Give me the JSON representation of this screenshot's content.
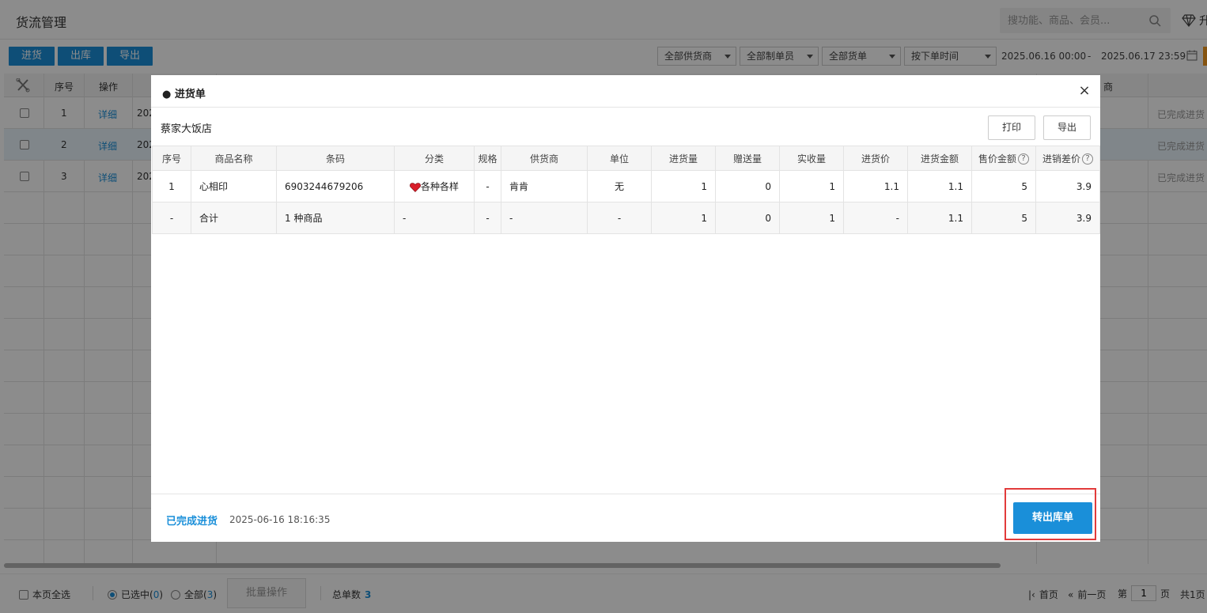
{
  "header": {
    "title": "货流管理",
    "search_placeholder": "搜功能、商品、会员...",
    "upgrade_label": "升"
  },
  "toolbar": {
    "purchase_label": "进货",
    "outbound_label": "出库",
    "export_label": "导出",
    "filters": {
      "supplier": "全部供货商",
      "creator": "全部制单员",
      "type": "全部货单",
      "time_mode": "按下单时间",
      "date_from": "2025.06.16 00:00",
      "date_sep": "-",
      "date_to": "2025.06.17 23:59"
    }
  },
  "grid": {
    "columns": [
      "序号",
      "操作",
      "商"
    ],
    "rows": [
      {
        "no": "1",
        "action": "详细",
        "prefix": "202",
        "status": "已完成进货"
      },
      {
        "no": "2",
        "action": "详细",
        "prefix": "202",
        "status": "已完成进货"
      },
      {
        "no": "3",
        "action": "详细",
        "prefix": "202",
        "status": "已完成进货"
      }
    ]
  },
  "footer": {
    "select_page_label": "本页全选",
    "selected_label": "已选中(",
    "selected_count": "0",
    "all_label": "全部(",
    "all_count": "3",
    "close_paren": ")",
    "batch_label": "批量操作",
    "total_label": "总单数",
    "total_count": "3",
    "first_page": "首页",
    "prev_page": "前一页",
    "page_prefix": "第",
    "page_value": "1",
    "page_suffix": "页",
    "total_pages": "共1页"
  },
  "modal": {
    "title": "● 进货单",
    "close_glyph": "×",
    "store_name": "蔡家大饭店",
    "print_label": "打印",
    "export_label": "导出",
    "columns": [
      "序号",
      "商品名称",
      "条码",
      "分类",
      "规格",
      "供货商",
      "单位",
      "进货量",
      "赠送量",
      "实收量",
      "进货价",
      "进货金额",
      "售价金额",
      "进销差价"
    ],
    "help_glyph": "?",
    "rows": [
      {
        "no": "1",
        "name": "心相印",
        "barcode": "6903244679206",
        "category": "各种各样",
        "spec": "-",
        "supplier": "肯肯",
        "unit": "无",
        "qty": "1",
        "gift": "0",
        "received": "1",
        "price": "1.1",
        "amount": "1.1",
        "sale_amount": "5",
        "margin": "3.9"
      }
    ],
    "total_row": {
      "no": "-",
      "name": "合计",
      "barcode": "1 种商品",
      "category": "-",
      "spec": "-",
      "supplier": "-",
      "unit": "-",
      "qty": "1",
      "gift": "0",
      "received": "1",
      "price": "-",
      "amount": "1.1",
      "sale_amount": "5",
      "margin": "3.9"
    },
    "status": "已完成进货",
    "timestamp": "2025-06-16 18:16:35",
    "convert_label": "转出库单"
  },
  "colors": {
    "accent": "#1a8fd9",
    "highlight_border": "#e23b3b",
    "heart": "#d81e2a"
  }
}
